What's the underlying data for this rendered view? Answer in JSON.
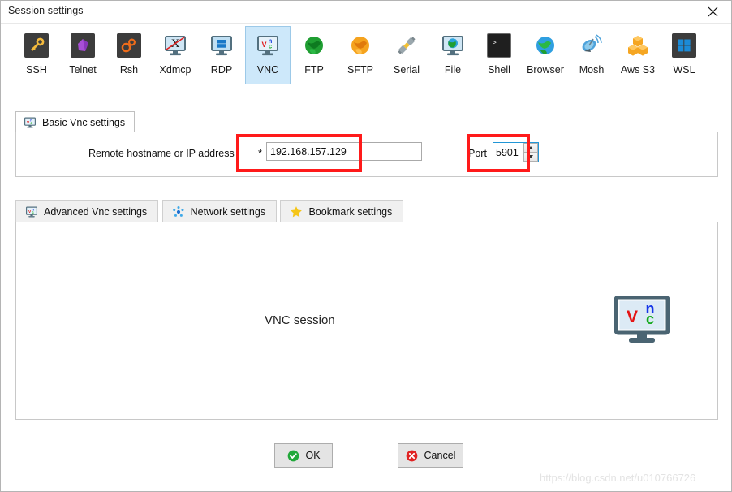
{
  "window": {
    "title": "Session settings",
    "close_label": "✕",
    "close_icon": "close-icon"
  },
  "toolbar": {
    "selected": "VNC",
    "items": [
      {
        "label": "SSH",
        "icon": "key-icon"
      },
      {
        "label": "Telnet",
        "icon": "gem-icon"
      },
      {
        "label": "Rsh",
        "icon": "gears-icon"
      },
      {
        "label": "Xdmcp",
        "icon": "x-monitor-icon"
      },
      {
        "label": "RDP",
        "icon": "windows-monitor-icon"
      },
      {
        "label": "VNC",
        "icon": "vnc-monitor-icon"
      },
      {
        "label": "FTP",
        "icon": "green-globe-icon"
      },
      {
        "label": "SFTP",
        "icon": "orange-globe-icon"
      },
      {
        "label": "Serial",
        "icon": "serial-plug-icon"
      },
      {
        "label": "File",
        "icon": "file-share-monitor-icon"
      },
      {
        "label": "Shell",
        "icon": "terminal-icon"
      },
      {
        "label": "Browser",
        "icon": "blue-globe-icon"
      },
      {
        "label": "Mosh",
        "icon": "satellite-dish-icon"
      },
      {
        "label": "Aws S3",
        "icon": "aws-cubes-icon"
      },
      {
        "label": "WSL",
        "icon": "windows-icon"
      }
    ]
  },
  "basic_tab": {
    "label": "Basic Vnc settings",
    "icon": "vnc-monitor-icon",
    "active": true
  },
  "form": {
    "hostname_label": "Remote hostname or IP address",
    "required_marker": "*",
    "hostname_value": "192.168.157.129",
    "hostname_placeholder": "",
    "port_label": "Port",
    "port_value": "5901",
    "spin_up_icon": "chevron-up-icon",
    "spin_down_icon": "chevron-down-icon",
    "annotation_color": "#ff1a1a"
  },
  "bottom_tabs": [
    {
      "label": "Advanced Vnc settings",
      "icon": "vnc-monitor-icon"
    },
    {
      "label": "Network settings",
      "icon": "network-nodes-icon"
    },
    {
      "label": "Bookmark settings",
      "icon": "star-icon"
    }
  ],
  "panel": {
    "session_caption": "VNC session",
    "logo_icon": "vnc-monitor-large-icon",
    "logo_letters": {
      "v": "V",
      "n": "N",
      "c": "C"
    }
  },
  "footer": {
    "ok_label": "OK",
    "ok_icon": "check-circle-icon",
    "cancel_label": "Cancel",
    "cancel_icon": "x-circle-icon"
  },
  "watermark": "https://blog.csdn.net/u010766726"
}
